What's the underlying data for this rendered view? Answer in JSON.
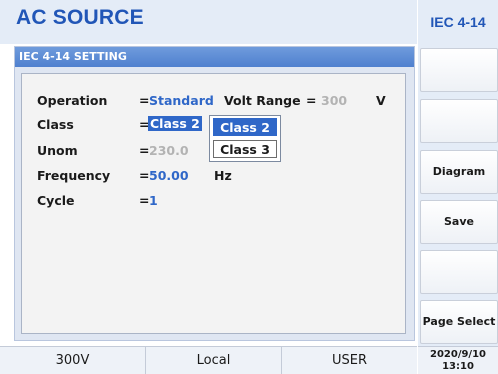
{
  "header": {
    "title": "AC SOURCE",
    "mode": "IEC 4-14"
  },
  "panel": {
    "title": "IEC 4-14 SETTING",
    "rows": {
      "operation": {
        "label": "Operation",
        "eq": "=",
        "value": "Standard"
      },
      "volt_range": {
        "label": "Volt Range",
        "eq": "=",
        "value": "300",
        "unit": "V"
      },
      "class": {
        "label": "Class",
        "eq": "=",
        "value": "Class 2"
      },
      "unom": {
        "label": "Unom",
        "eq": "=",
        "value": "230.0"
      },
      "frequency": {
        "label": "Frequency",
        "eq": "=",
        "value": "50.00",
        "unit": "Hz"
      },
      "cycle": {
        "label": "Cycle",
        "eq": "=",
        "value": "1"
      }
    },
    "class_dropdown": {
      "options": [
        "Class 2",
        "Class 3"
      ],
      "selected": "Class 2"
    }
  },
  "softkeys": [
    "",
    "",
    "Diagram",
    "Save",
    "",
    "Page Select"
  ],
  "status": {
    "range": "300V",
    "control": "Local",
    "user": "USER",
    "date": "2020/9/10",
    "time": "13:10"
  },
  "colors": {
    "title": "#2156b7",
    "accent": "#2f67c8",
    "panel_title_bar": "#4f80cf",
    "disabled_value": "#b3b3b3"
  }
}
